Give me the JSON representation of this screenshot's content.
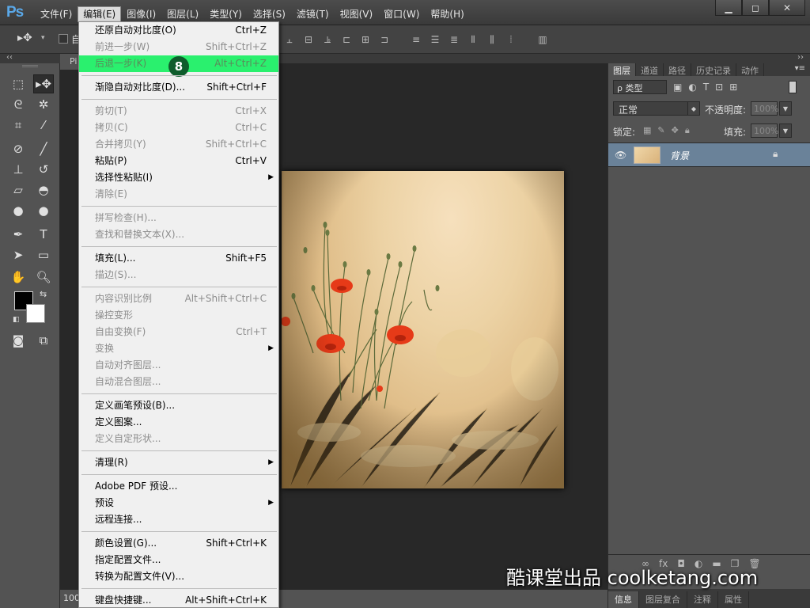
{
  "app": {
    "logo": "Ps",
    "doc_tab_label": "Pi",
    "zoom": "100"
  },
  "window_controls": {
    "minimize": "▁",
    "maximize": "◻",
    "close": "✕"
  },
  "menubar": [
    "文件(F)",
    "编辑(E)",
    "图像(I)",
    "图层(L)",
    "类型(Y)",
    "选择(S)",
    "滤镜(T)",
    "视图(V)",
    "窗口(W)",
    "帮助(H)"
  ],
  "options_bar": {
    "auto_select_label": "自"
  },
  "edit_menu": [
    {
      "label": "还原自动对比度(O)",
      "shortcut": "Ctrl+Z",
      "enabled": true
    },
    {
      "label": "前进一步(W)",
      "shortcut": "Shift+Ctrl+Z",
      "enabled": false
    },
    {
      "label": "后退一步(K)",
      "shortcut": "Alt+Ctrl+Z",
      "enabled": true,
      "highlighted": true,
      "step_badge": "8"
    },
    {
      "separator": true
    },
    {
      "label": "渐隐自动对比度(D)...",
      "shortcut": "Shift+Ctrl+F",
      "enabled": true
    },
    {
      "separator": true
    },
    {
      "label": "剪切(T)",
      "shortcut": "Ctrl+X",
      "enabled": false
    },
    {
      "label": "拷贝(C)",
      "shortcut": "Ctrl+C",
      "enabled": false
    },
    {
      "label": "合并拷贝(Y)",
      "shortcut": "Shift+Ctrl+C",
      "enabled": false
    },
    {
      "label": "粘贴(P)",
      "shortcut": "Ctrl+V",
      "enabled": true
    },
    {
      "label": "选择性粘贴(I)",
      "shortcut": "",
      "enabled": true,
      "submenu": true
    },
    {
      "label": "清除(E)",
      "shortcut": "",
      "enabled": false
    },
    {
      "separator": true
    },
    {
      "label": "拼写检查(H)...",
      "shortcut": "",
      "enabled": false
    },
    {
      "label": "查找和替换文本(X)...",
      "shortcut": "",
      "enabled": false
    },
    {
      "separator": true
    },
    {
      "label": "填充(L)...",
      "shortcut": "Shift+F5",
      "enabled": true
    },
    {
      "label": "描边(S)...",
      "shortcut": "",
      "enabled": false
    },
    {
      "separator": true
    },
    {
      "label": "内容识别比例",
      "shortcut": "Alt+Shift+Ctrl+C",
      "enabled": false
    },
    {
      "label": "操控变形",
      "shortcut": "",
      "enabled": false
    },
    {
      "label": "自由变换(F)",
      "shortcut": "Ctrl+T",
      "enabled": false
    },
    {
      "label": "变换",
      "shortcut": "",
      "enabled": false,
      "submenu": true
    },
    {
      "label": "自动对齐图层...",
      "shortcut": "",
      "enabled": false
    },
    {
      "label": "自动混合图层...",
      "shortcut": "",
      "enabled": false
    },
    {
      "separator": true
    },
    {
      "label": "定义画笔预设(B)...",
      "shortcut": "",
      "enabled": true
    },
    {
      "label": "定义图案...",
      "shortcut": "",
      "enabled": true
    },
    {
      "label": "定义自定形状...",
      "shortcut": "",
      "enabled": false
    },
    {
      "separator": true
    },
    {
      "label": "清理(R)",
      "shortcut": "",
      "enabled": true,
      "submenu": true
    },
    {
      "separator": true
    },
    {
      "label": "Adobe PDF 预设...",
      "shortcut": "",
      "enabled": true
    },
    {
      "label": "预设",
      "shortcut": "",
      "enabled": true,
      "submenu": true
    },
    {
      "label": "远程连接...",
      "shortcut": "",
      "enabled": true
    },
    {
      "separator": true
    },
    {
      "label": "颜色设置(G)...",
      "shortcut": "Shift+Ctrl+K",
      "enabled": true
    },
    {
      "label": "指定配置文件...",
      "shortcut": "",
      "enabled": true
    },
    {
      "label": "转换为配置文件(V)...",
      "shortcut": "",
      "enabled": true
    },
    {
      "separator": true
    },
    {
      "label": "键盘快捷键...",
      "shortcut": "Alt+Shift+Ctrl+K",
      "enabled": true
    }
  ],
  "layers_panel": {
    "tabs": [
      "图层",
      "通道",
      "路径",
      "历史记录",
      "动作"
    ],
    "filter_label": "ρ 类型",
    "blend_mode": "正常",
    "opacity_label": "不透明度:",
    "opacity_value": "100%",
    "lock_label": "锁定:",
    "fill_label": "填充:",
    "fill_value": "100%",
    "layers": [
      {
        "name": "背景",
        "visible": true,
        "locked": true
      }
    ]
  },
  "bottom_tabs": [
    "信息",
    "图层复合",
    "注释",
    "属性"
  ],
  "watermark": "酷课堂出品 coolketang.com",
  "colors": {
    "highlight": "#2af06e",
    "badge": "#0f5c2c",
    "layer_selected": "#6a8299"
  }
}
